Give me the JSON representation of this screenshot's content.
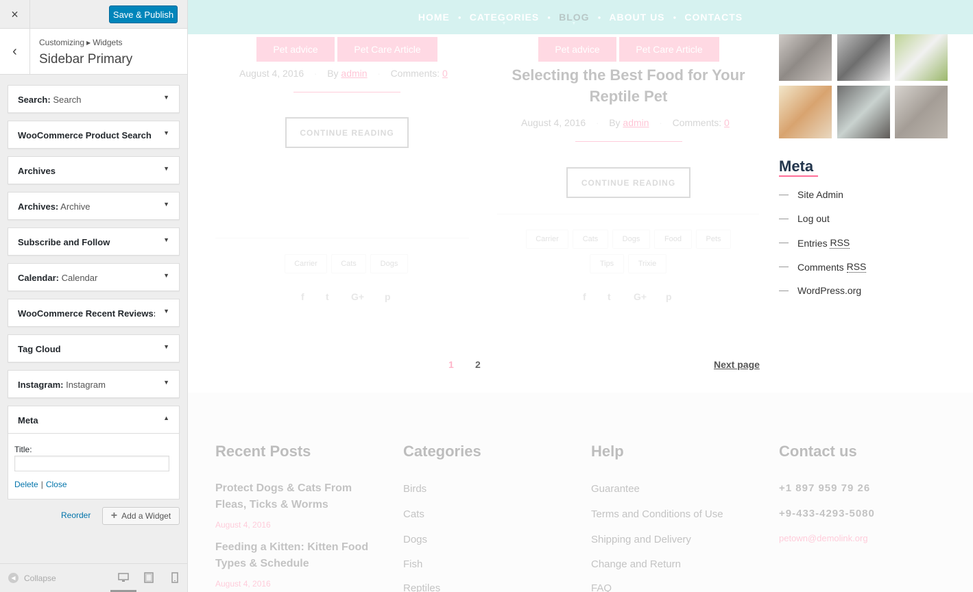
{
  "customizer": {
    "close_icon": "×",
    "save_label": "Save & Publish",
    "back_icon": "‹",
    "breadcrumb": [
      "Customizing",
      "Widgets"
    ],
    "panel_title": "Sidebar Primary",
    "widgets": [
      {
        "name": "Search:",
        "sub": "Search"
      },
      {
        "name": "WooCommerce Product Search",
        "sub": ""
      },
      {
        "name": "Archives",
        "sub": ""
      },
      {
        "name": "Archives:",
        "sub": "Archive"
      },
      {
        "name": "Subscribe and Follow",
        "sub": ""
      },
      {
        "name": "Calendar:",
        "sub": "Calendar"
      },
      {
        "name": "WooCommerce Recent Reviews: ...",
        "sub": ""
      },
      {
        "name": "Tag Cloud",
        "sub": ""
      },
      {
        "name": "Instagram:",
        "sub": "Instagram"
      },
      {
        "name": "Meta",
        "sub": ""
      }
    ],
    "meta_form": {
      "title_label": "Title:",
      "title_value": "",
      "delete_label": "Delete",
      "separator": "|",
      "close_label": "Close"
    },
    "reorder_label": "Reorder",
    "add_widget_label": "Add a Widget",
    "collapse_label": "Collapse",
    "colors": {
      "primary": "#0085ba",
      "link": "#0073aa"
    }
  },
  "preview": {
    "nav": [
      "HOME",
      "CATEGORIES",
      "BLOG",
      "ABOUT US",
      "CONTACTS"
    ],
    "nav_active": "BLOG",
    "posts": [
      {
        "tags": [
          "Pet advice",
          "Pet Care Article"
        ],
        "date": "August 4, 2016",
        "by": "By",
        "author": "admin",
        "comments_label": "Comments:",
        "comments": "0",
        "button": "CONTINUE READING",
        "tag_cloud": [
          "Carrier",
          "Cats",
          "Dogs"
        ]
      },
      {
        "tags": [
          "Pet advice",
          "Pet Care Article"
        ],
        "title": "Selecting the Best Food for Your Reptile Pet",
        "date": "August 4, 2016",
        "by": "By",
        "author": "admin",
        "comments_label": "Comments:",
        "comments": "0",
        "button": "CONTINUE READING",
        "tag_cloud": [
          "Carrier",
          "Cats",
          "Dogs",
          "Food",
          "Pets",
          "Tips",
          "Trixie"
        ]
      }
    ],
    "share_icons": [
      "f",
      "t",
      "G+",
      "p"
    ],
    "pagination": {
      "pages": [
        "1",
        "2"
      ],
      "next": "Next page"
    },
    "meta": {
      "title": "Meta",
      "items": [
        {
          "text": "Site Admin",
          "abbr": ""
        },
        {
          "text": "Log out",
          "abbr": ""
        },
        {
          "text": "Entries",
          "abbr": "RSS"
        },
        {
          "text": "Comments",
          "abbr": "RSS"
        },
        {
          "text": "WordPress.org",
          "abbr": ""
        }
      ]
    },
    "footer": {
      "recent_posts": {
        "title": "Recent Posts",
        "posts": [
          {
            "title": "Protect Dogs & Cats From Fleas, Ticks & Worms",
            "date": "August 4, 2016"
          },
          {
            "title": "Feeding a Kitten: Kitten Food Types & Schedule",
            "date": "August 4, 2016"
          }
        ]
      },
      "categories": {
        "title": "Categories",
        "items": [
          "Birds",
          "Cats",
          "Dogs",
          "Fish",
          "Reptiles"
        ]
      },
      "help": {
        "title": "Help",
        "items": [
          "Guarantee",
          "Terms and Conditions of Use",
          "Shipping and Delivery",
          "Change and Return",
          "FAQ"
        ]
      },
      "contact": {
        "title": "Contact us",
        "phone1": "+1 897 959 79 26",
        "phone2": "+9-433-4293-5080",
        "email": "petown@demolink.org"
      }
    }
  }
}
